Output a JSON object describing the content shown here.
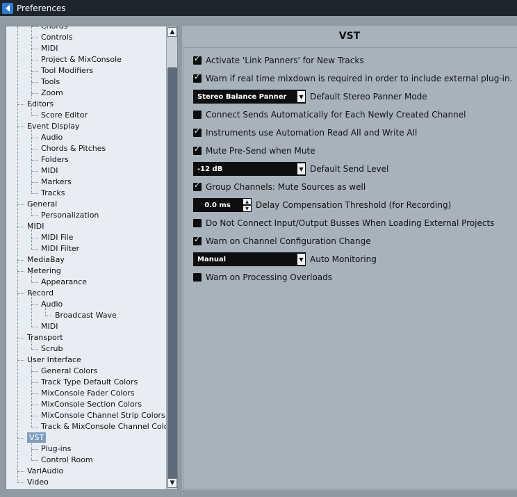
{
  "window": {
    "title": "Preferences"
  },
  "tree": {
    "items": [
      {
        "label": "Chords"
      },
      {
        "label": "Controls"
      },
      {
        "label": "MIDI"
      },
      {
        "label": "Project & MixConsole"
      },
      {
        "label": "Tool Modifiers"
      },
      {
        "label": "Tools"
      },
      {
        "label": "Zoom"
      },
      {
        "label": "Editors"
      },
      {
        "label": "Score Editor"
      },
      {
        "label": "Event Display"
      },
      {
        "label": "Audio"
      },
      {
        "label": "Chords & Pitches"
      },
      {
        "label": "Folders"
      },
      {
        "label": "MIDI"
      },
      {
        "label": "Markers"
      },
      {
        "label": "Tracks"
      },
      {
        "label": "General"
      },
      {
        "label": "Personalization"
      },
      {
        "label": "MIDI"
      },
      {
        "label": "MIDI File"
      },
      {
        "label": "MIDI Filter"
      },
      {
        "label": "MediaBay"
      },
      {
        "label": "Metering"
      },
      {
        "label": "Appearance"
      },
      {
        "label": "Record"
      },
      {
        "label": "Audio"
      },
      {
        "label": "Broadcast Wave"
      },
      {
        "label": "MIDI"
      },
      {
        "label": "Transport"
      },
      {
        "label": "Scrub"
      },
      {
        "label": "User Interface"
      },
      {
        "label": "General Colors"
      },
      {
        "label": "Track Type Default Colors"
      },
      {
        "label": "MixConsole Fader Colors"
      },
      {
        "label": "MixConsole Section Colors"
      },
      {
        "label": "MixConsole Channel Strip Colors"
      },
      {
        "label": "Track & MixConsole Channel Colors"
      },
      {
        "label": "VST"
      },
      {
        "label": "Plug-ins"
      },
      {
        "label": "Control Room"
      },
      {
        "label": "VariAudio"
      },
      {
        "label": "Video"
      }
    ],
    "selected": "VST"
  },
  "panel": {
    "title": "VST",
    "options": {
      "link_panners": {
        "label": "Activate 'Link Panners' for New Tracks",
        "checked": true
      },
      "warn_realtime": {
        "label": "Warn if real time mixdown is required in order to include external plug-in.",
        "checked": true
      },
      "stereo_panner": {
        "value": "Stereo Balance Panner",
        "label": "Default Stereo Panner Mode"
      },
      "connect_sends": {
        "label": "Connect Sends Automatically for Each Newly Created Channel",
        "checked": false
      },
      "instruments_automation": {
        "label": "Instruments use Automation Read All and Write All",
        "checked": true
      },
      "mute_presend": {
        "label": "Mute Pre-Send when Mute",
        "checked": true
      },
      "send_level": {
        "value": "-12 dB",
        "label": "Default Send Level"
      },
      "group_mute": {
        "label": "Group Channels: Mute Sources as well",
        "checked": true
      },
      "delay_comp": {
        "value": "0.0 ms",
        "label": "Delay Compensation Threshold (for Recording)"
      },
      "no_connect_busses": {
        "label": "Do Not Connect Input/Output Busses When Loading External Projects",
        "checked": false
      },
      "warn_channel_config": {
        "label": "Warn on Channel Configuration Change",
        "checked": true
      },
      "auto_monitoring": {
        "value": "Manual",
        "label": "Auto Monitoring"
      },
      "warn_overloads": {
        "label": "Warn on Processing Overloads",
        "checked": false
      }
    }
  },
  "icons": {
    "app": "cubase-back-icon",
    "scroll_up": "chevron-up-icon",
    "scroll_down": "chevron-down-icon",
    "dropdown": "chevron-down-icon"
  },
  "colors": {
    "titlebar": "#1e252b",
    "tree_bg": "#e7edf2",
    "panel_bg": "#a7b2bc",
    "selection": "#7f9fbf",
    "control_bg": "#0e0e0e"
  }
}
